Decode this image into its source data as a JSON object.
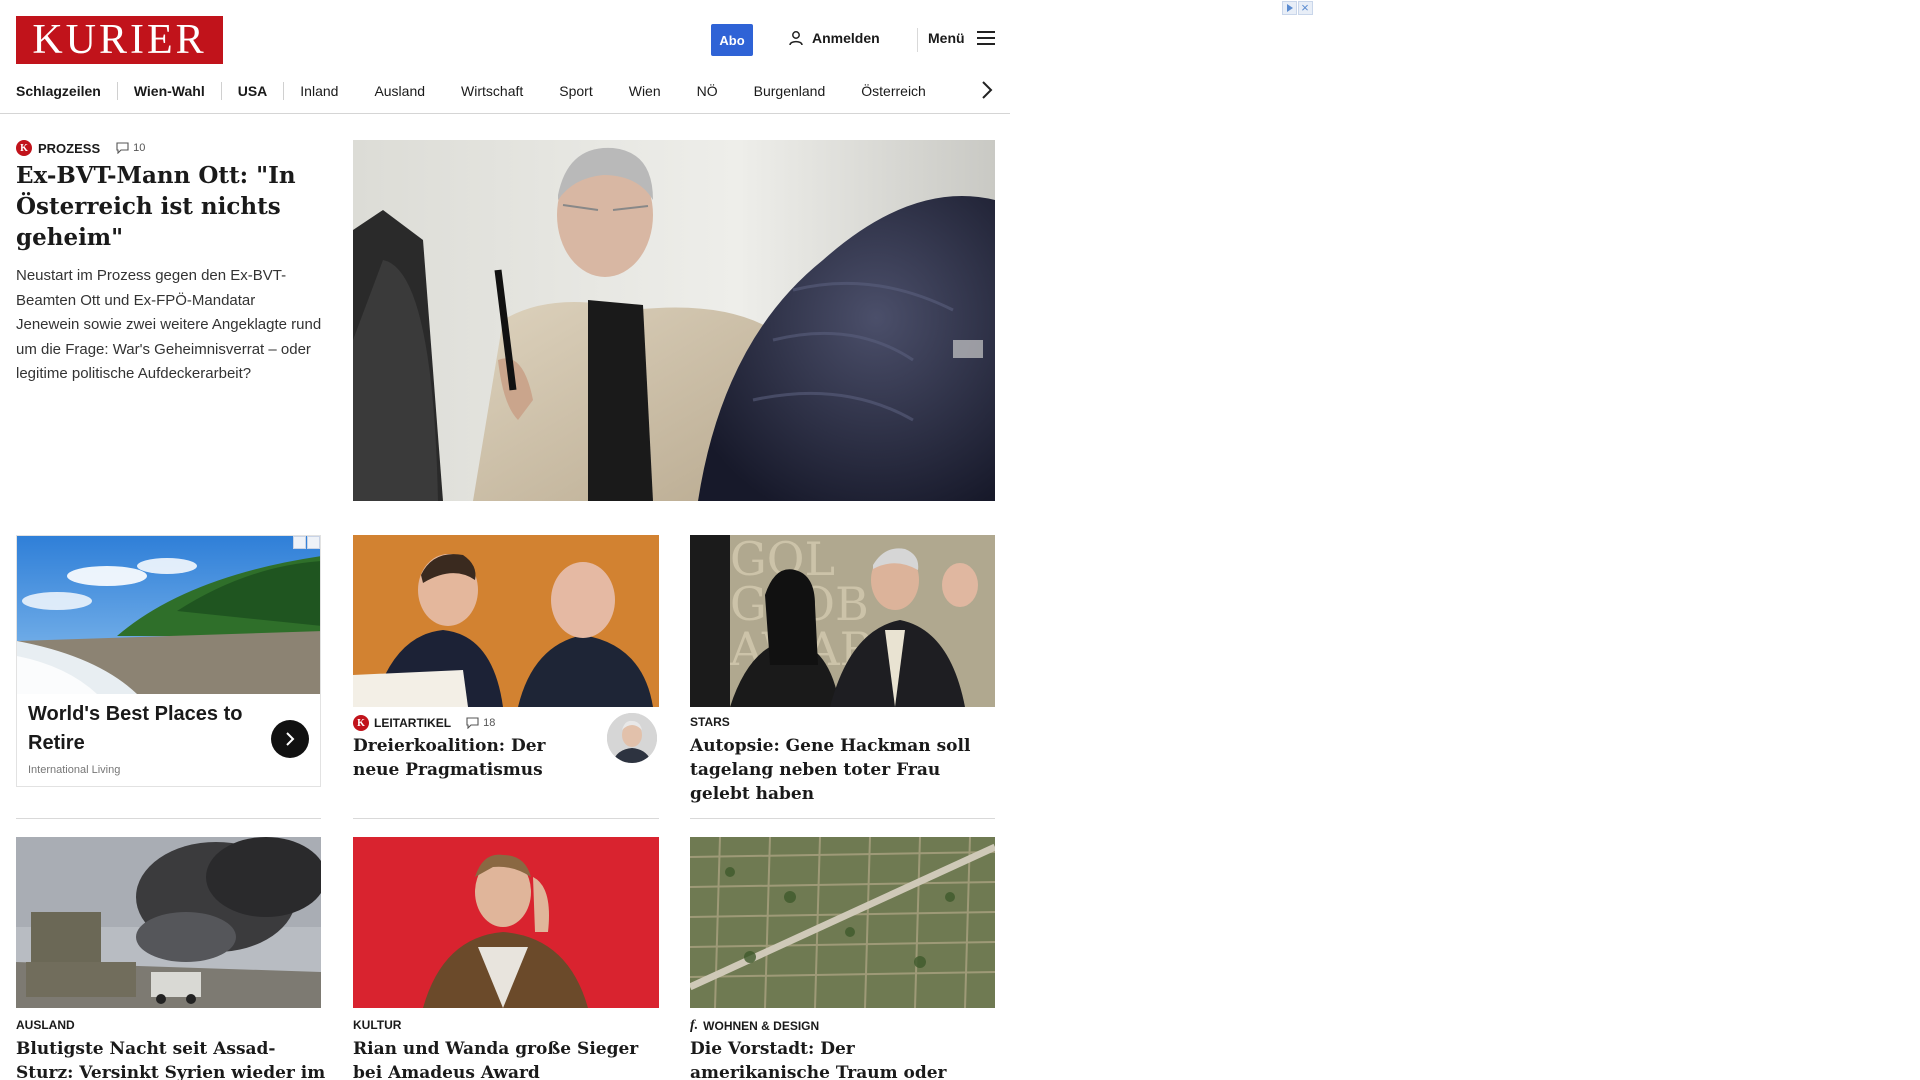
{
  "header": {
    "logo": "KURIER",
    "abo_label": "Abo",
    "login_label": "Anmelden",
    "menu_label": "Menü"
  },
  "nav": {
    "items": [
      "Schlagzeilen",
      "Wien-Wahl",
      "USA",
      "Inland",
      "Ausland",
      "Wirtschaft",
      "Sport",
      "Wien",
      "NÖ",
      "Burgenland",
      "Österreich"
    ]
  },
  "lead": {
    "category": "PROZESS",
    "comments": "10",
    "title": "Ex-BVT-Mann Ott: \"In Österreich ist nichts geheim\"",
    "teaser": "Neustart im Prozess gegen den Ex-BVT-Beamten Ott und Ex-FPÖ-Mandatar Jenewein sowie zwei weitere Angeklagte rund um die Frage: War's Geheimnisverrat – oder legitime politische Aufdeckerarbeit?"
  },
  "ad": {
    "title": "World's Best Places to Retire",
    "source": "International Living"
  },
  "cards": [
    {
      "category": "LEITARTIKEL",
      "comments": "18",
      "title": "Dreierkoalition: Der neue Pragmatismus"
    },
    {
      "category": "STARS",
      "title": "Autopsie: Gene Hackman soll tagelang neben toter Frau gelebt haben"
    },
    {
      "category": "AUSLAND",
      "title": "Blutigste Nacht seit Assad-Sturz: Versinkt Syrien wieder im Chaos?"
    },
    {
      "category": "KULTUR",
      "title": "Rian und Wanda große Sieger bei Amadeus Award"
    },
    {
      "category": "WOHNEN & DESIGN",
      "title": "Die Vorstadt: Der amerikanische Traum oder Alptraum?"
    }
  ],
  "colors": {
    "brand": "#c1131b",
    "accent": "#2f63d6"
  }
}
